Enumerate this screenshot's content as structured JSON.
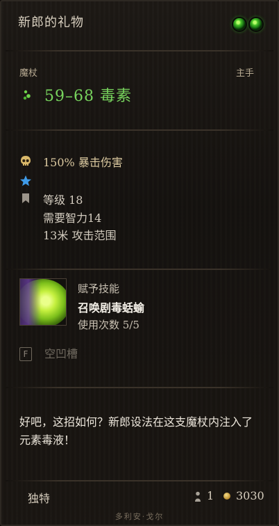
{
  "item": {
    "name": "新郎的礼物",
    "weapon_type": "魔杖",
    "slot": "主手",
    "damage": "59–68 毒素",
    "rune_sockets": 2
  },
  "stats": {
    "crit_damage": "150% 暴击伤害",
    "level": "等级 18",
    "requirement": "需要智力14",
    "range": "13米 攻击范围"
  },
  "skill": {
    "grant_label": "赋予技能",
    "name": "召唤剧毒蛞蝓",
    "uses": "使用次数 5/5"
  },
  "slot": {
    "icon_letter": "F",
    "label": "空凹槽"
  },
  "flavor_text": "好吧，这招如何？新郎设法在这支魔杖内注入了元素毒液！",
  "footer_info": {
    "rarity": "独特",
    "stack": "1",
    "price": "3030",
    "owner": "多利安·戈尔"
  },
  "colors": {
    "damage_green": "#77d35d",
    "crit_gold": "#dbc9a0",
    "star_blue": "#3f9be8",
    "socket_green": "#47c228"
  }
}
